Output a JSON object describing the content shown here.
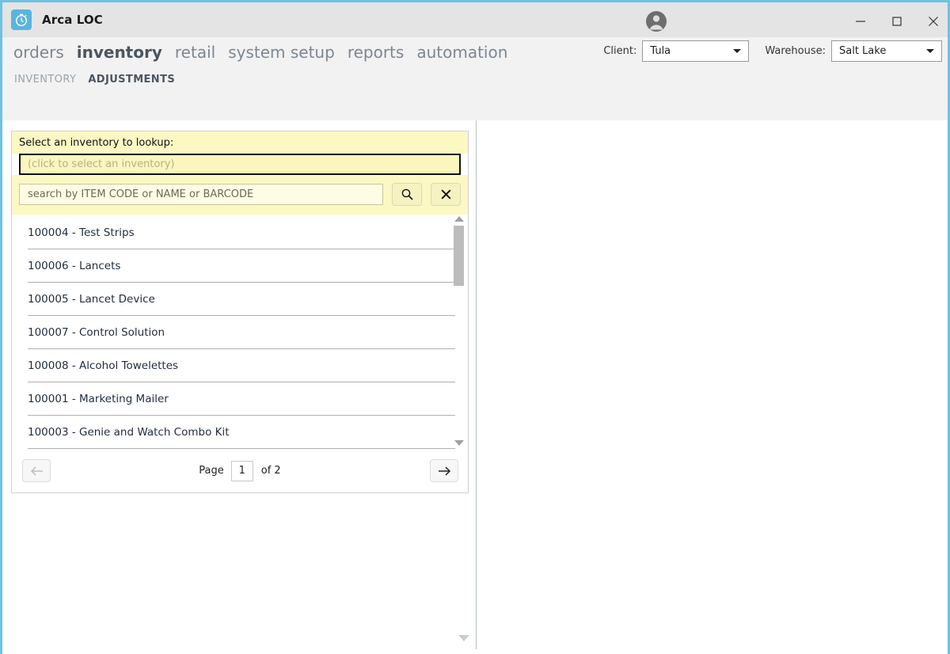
{
  "window": {
    "app_icon": "stopwatch-icon",
    "title": "Arca LOC",
    "controls": {
      "minimize": "minimize-icon",
      "maximize": "maximize-icon",
      "close": "close-icon"
    },
    "avatar": "user-avatar-icon"
  },
  "main_nav": {
    "items": [
      {
        "label": "orders",
        "active": false
      },
      {
        "label": "inventory",
        "active": true
      },
      {
        "label": "retail",
        "active": false
      },
      {
        "label": "system setup",
        "active": false
      },
      {
        "label": "reports",
        "active": false
      },
      {
        "label": "automation",
        "active": false
      }
    ]
  },
  "sub_nav": {
    "items": [
      {
        "label": "INVENTORY",
        "active": false
      },
      {
        "label": "ADJUSTMENTS",
        "active": true
      }
    ]
  },
  "context_selectors": {
    "client_label": "Client:",
    "client_value": "Tula",
    "warehouse_label": "Warehouse:",
    "warehouse_value": "Salt Lake"
  },
  "lookup": {
    "heading": "Select an inventory to lookup:",
    "selected_placeholder": "(click to select an inventory)",
    "search_placeholder": "search by ITEM CODE or NAME or BARCODE",
    "search_button_icon": "search-icon",
    "clear_button_icon": "close-icon",
    "results": [
      {
        "label": "100004 - Test Strips"
      },
      {
        "label": "100006 - Lancets"
      },
      {
        "label": "100005 - Lancet Device"
      },
      {
        "label": "100007 - Control Solution"
      },
      {
        "label": "100008 - Alcohol Towelettes"
      },
      {
        "label": "100001 - Marketing Mailer"
      },
      {
        "label": "100003 - Genie and Watch Combo Kit"
      }
    ],
    "pagination": {
      "prev_icon": "arrow-left-icon",
      "next_icon": "arrow-right-icon",
      "page_label": "Page",
      "page_value": "1",
      "of_label": "of 2"
    }
  },
  "colors": {
    "window_border": "#6ec1e4",
    "titlebar_bg": "#e4e4e4",
    "nav_bg": "#f2f2f2",
    "nav_text": "#7b8794",
    "nav_active_text": "#4a5560",
    "lookup_yellow": "#fbf8c4",
    "field_yellow": "#fefce4",
    "accent_blue": "#5bb4dd"
  }
}
